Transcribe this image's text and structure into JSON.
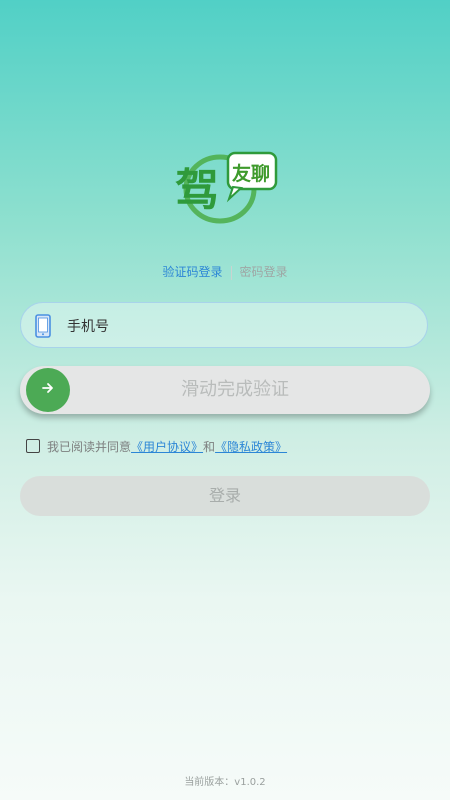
{
  "logo": {
    "main_char": "驾",
    "secondary": "友聊"
  },
  "tabs": [
    {
      "label": "验证码登录",
      "active": true
    },
    {
      "label": "密码登录",
      "active": false
    }
  ],
  "phone": {
    "placeholder": "手机号",
    "value": ""
  },
  "slider": {
    "label": "滑动完成验证",
    "handle_icon": "arrow-right-icon"
  },
  "agreement": {
    "checked": false,
    "prefix": "我已阅读并同意",
    "user_agreement": "《用户协议》",
    "and": "和",
    "privacy_policy": "《隐私政策》"
  },
  "login_button": {
    "label": "登录",
    "enabled": false
  },
  "version": {
    "text": "当前版本：v1.0.2"
  },
  "colors": {
    "accent": "#2c86d6",
    "slider_handle": "#4caa55",
    "logo_green": "#2f9a3b"
  }
}
